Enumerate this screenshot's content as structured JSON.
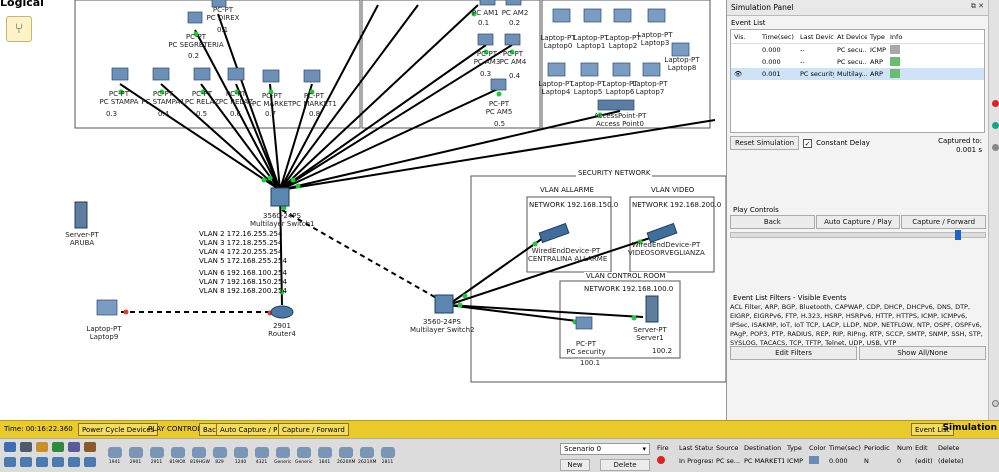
{
  "workspace": {
    "tab_title": "Logical",
    "nodes": {
      "pc_direx": {
        "type": "PC-PT",
        "name": "PC DIREX",
        "ip": "0.1"
      },
      "pc_segreteria": {
        "type": "PC-PT",
        "name": "PC SEGRETERIA",
        "ip": "0.2"
      },
      "pc_stampa": {
        "type": "PC-PT",
        "name": "PC STAMPA",
        "ip": "0.3"
      },
      "pc_stampa1": {
        "type": "PC-PT",
        "name": "PC STAMPA1",
        "ip": "0.4"
      },
      "pc_relaz": {
        "type": "PC-PT",
        "name": "PC RELAZ",
        "ip": "0.5"
      },
      "pc_relaz1": {
        "type": "PC-PT",
        "name": "PC RELAZ",
        "ip": "0.6"
      },
      "pc_market": {
        "type": "PC-PT",
        "name": "PC MARKET",
        "ip": "0.7"
      },
      "pc_market1": {
        "type": "PC-PT",
        "name": "PC MARKET1",
        "ip": "0.8"
      },
      "pc_am1": {
        "type": "PC-PT",
        "name": "PC AM1",
        "ip": "0.1"
      },
      "pc_am2": {
        "type": "PC-PT",
        "name": "PC AM2",
        "ip": "0.2"
      },
      "pc_am3": {
        "type": "PC-PT",
        "name": "PC AM3",
        "ip": "0.3"
      },
      "pc_am4": {
        "type": "PC-PT",
        "name": "PC AM4",
        "ip": "0.4"
      },
      "pc_am5": {
        "type": "PC-PT",
        "name": "PC AM5",
        "ip": "0.5"
      },
      "laptop0": {
        "type": "Laptop-PT",
        "name": "Laptop0"
      },
      "laptop1": {
        "type": "Laptop-PT",
        "name": "Laptop1"
      },
      "laptop2": {
        "type": "Laptop-PT",
        "name": "Laptop2"
      },
      "laptop3": {
        "type": "Laptop-PT",
        "name": "Laptop3"
      },
      "laptop4": {
        "type": "Laptop-PT",
        "name": "Laptop4"
      },
      "laptop5": {
        "type": "Laptop-PT",
        "name": "Laptop5"
      },
      "laptop6": {
        "type": "Laptop-PT",
        "name": "Laptop6"
      },
      "laptop7": {
        "type": "Laptop-PT",
        "name": "Laptop7"
      },
      "laptop8": {
        "type": "Laptop-PT",
        "name": "Laptop8"
      },
      "access_point": {
        "type": "AccessPoint-PT",
        "name": "Access Point0"
      },
      "switch1": {
        "type": "3560-24PS",
        "name": "Multilayer Switch1"
      },
      "switch2": {
        "type": "3560-24PS",
        "name": "Multilayer Switch2"
      },
      "server_aruba": {
        "type": "Server-PT",
        "name": "ARUBA"
      },
      "router4": {
        "type": "2901",
        "name": "Router4"
      },
      "laptop9": {
        "type": "Laptop-PT",
        "name": "Laptop9"
      },
      "centralina": {
        "type": "WiredEndDevice-PT",
        "name": "CENTRALINA ALLARME"
      },
      "videosorveglianza": {
        "type": "WiredEndDevice-PT",
        "name": "VIDEOSORVEGLIANZA"
      },
      "pc_security": {
        "type": "PC-PT",
        "name": "PC security",
        "ip": "100.1"
      },
      "server1": {
        "type": "Server-PT",
        "name": "Server1",
        "ip": "100.2"
      }
    },
    "vlans": [
      "VLAN 2 172.16.255.254",
      "VLAN 3 172.18.255.254",
      "VLAN 4 172.20.255.254",
      "VLAN 5 172.168.255.254",
      "VLAN 6 192.168.100.254",
      "VLAN 7 192.168.150.254",
      "VLAN 8 192.168.200.254"
    ],
    "security_network": {
      "title": "SECURITY NETWORK",
      "vlan_allarme": "VLAN ALLARME",
      "network_allarme": "NETWORK 192.168.150.0",
      "vlan_video": "VLAN VIDEO",
      "network_video": "NETWORK 192.168.200.0",
      "vlan_control": "VLAN CONTROL ROOM",
      "network_control": "NETWORK 192.168.100.0"
    }
  },
  "sim_panel": {
    "title": "Simulation Panel",
    "event_list_title": "Event List",
    "columns": [
      "Vis.",
      "Time(sec)",
      "Last Device",
      "At Device",
      "Type",
      "Info"
    ],
    "events": [
      {
        "time": "0.000",
        "last": "--",
        "at": "PC secu...",
        "type": "ICMP",
        "color": "#a8a8a8"
      },
      {
        "time": "0.000",
        "last": "--",
        "at": "PC secu...",
        "type": "ARP",
        "color": "#6cbb70"
      },
      {
        "time": "0.001",
        "last": "PC security",
        "at": "Multilay...",
        "type": "ARP",
        "color": "#6cbb70"
      }
    ],
    "reset_label": "Reset Simulation",
    "constant_delay": "Constant Delay",
    "captured_label": "Captured to:",
    "captured_value": "0.001 s",
    "play_controls_title": "Play Controls",
    "play_buttons": [
      "Back",
      "Auto Capture / Play",
      "Capture / Forward"
    ],
    "filters_title": "Event List Filters - Visible Events",
    "filters_text": "ACL Filter, ARP, BGP, Bluetooth, CAPWAP, CDP, DHCP, DHCPv6, DNS, DTP, EIGRP, EIGRPv6, FTP, H.323, HSRP, HSRPv6, HTTP, HTTPS, ICMP, ICMPv6, IPSec, ISAKMP, IoT, IoT TCP, LACP, LLDP, NDP, NETFLOW, NTP, OSPF, OSPFv6, PAgP, POP3, PTP, RADIUS, REP, RIP, RIPng, RTP, SCCP, SMTP, SNMP, SSH, STP, SYSLOG, TACACS, TCP, TFTP, Telnet, UDP, USB, VTP",
    "edit_filters": "Edit Filters",
    "show_all": "Show All/None",
    "header_controls": "⧉ ✕"
  },
  "bottom_bar": {
    "time": "Time: 00:16:22.360",
    "power_cycle": "Power Cycle Devices",
    "play_controls": "PLAY CONTROLS:",
    "back": "Back",
    "auto_capture": "Auto Capture / Play",
    "capture_forward": "Capture / Forward",
    "event_list": "Event List",
    "simulation": "Simulation"
  },
  "device_bar": {
    "devices": [
      "1941",
      "2901",
      "2911",
      "819IOX",
      "819HGW",
      "829",
      "1240",
      "4321",
      "Generic",
      "Generic",
      "1841",
      "2620XM",
      "2621XM",
      "2811"
    ],
    "scenario": "Scenario 0",
    "new": "New",
    "delete": "Delete",
    "pdu_columns": [
      "Fire",
      "Last Status",
      "Source",
      "Destination",
      "Type",
      "Color",
      "Time(sec)",
      "Periodic",
      "Num",
      "Edit",
      "Delete"
    ],
    "pdu_row": {
      "status": "In Progress",
      "source": "PC se...",
      "destination": "PC MARKET1",
      "type": "ICMP",
      "color": "#6a8bb5",
      "time": "0.000",
      "periodic": "N",
      "num": "0",
      "edit": "(edit)",
      "delete": "(delete)"
    }
  }
}
